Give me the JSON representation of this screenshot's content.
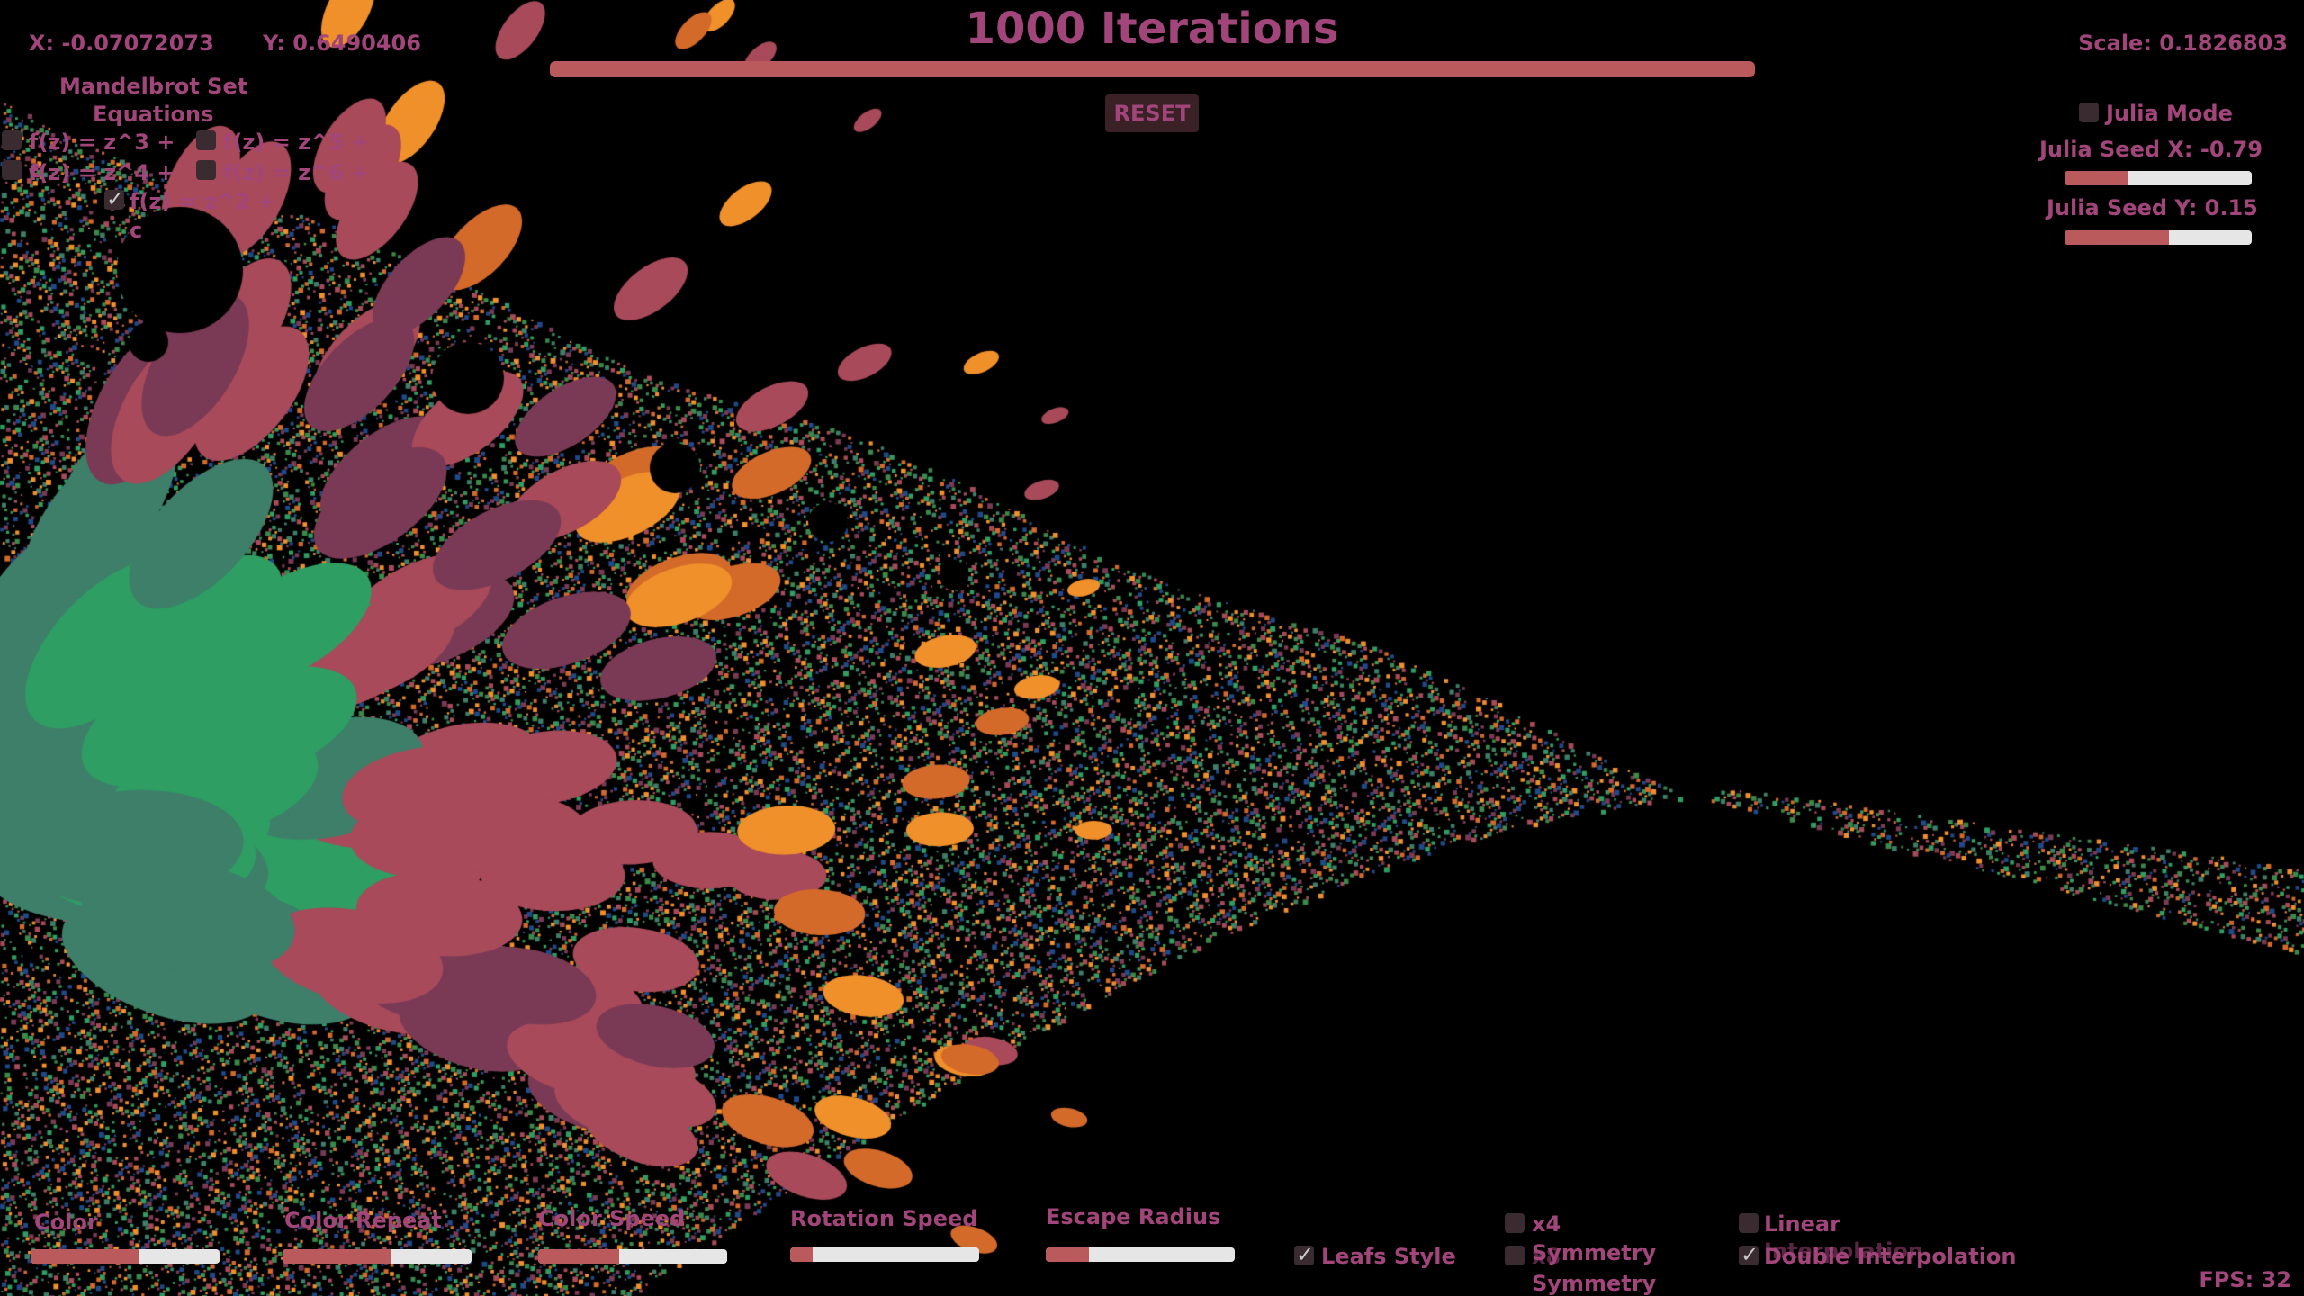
{
  "coords": {
    "x_label": "X: -0.07072073",
    "y_label": "Y: 0.6490406",
    "scale_label": "Scale: 0.1826803"
  },
  "iterations": {
    "title": "1000 Iterations",
    "progress": 1.0
  },
  "reset_label": "RESET",
  "equations": {
    "header_line1": "Mandelbrot Set",
    "header_line2": "Equations",
    "items": [
      {
        "label": "f(z) = z^3 +",
        "checked": false
      },
      {
        "label": "f(z) = z^5 +",
        "checked": false
      },
      {
        "label": "f(z) = z^4 +",
        "checked": false
      },
      {
        "label": "f(z) = z^6 +",
        "checked": false
      },
      {
        "label": "f(z) = z^2 +",
        "checked": true
      }
    ],
    "overflow_c1": "c",
    "overflow_c2": "c"
  },
  "julia": {
    "mode_label": "Julia Mode",
    "mode_checked": false,
    "seed_x_label": "Julia Seed X: -0.79",
    "seed_x_level": 0.34,
    "seed_y_label": "Julia Seed Y: 0.15",
    "seed_y_level": 0.56
  },
  "bottom_sliders": [
    {
      "label": "Color",
      "level": 0.57
    },
    {
      "label": "Color Repeat",
      "level": 0.57
    },
    {
      "label": "Color Speed",
      "level": 0.43
    },
    {
      "label": "Rotation Speed",
      "level": 0.12
    },
    {
      "label": "Escape Radius",
      "level": 0.23
    }
  ],
  "options": {
    "leafs_label": "Leafs Style",
    "leafs_checked": true,
    "x4_label": "x4",
    "x4_checked": false,
    "x8_label": "x8",
    "x8_checked": false,
    "symmetry_label": "Symmetry",
    "symmetry_label2": "Symmetry",
    "linear_label": "Linear",
    "linear_label2": "Interpolation",
    "linear_checked": false,
    "double_label": "Double Interpolation",
    "double_checked": true
  },
  "fps_label": "FPS: 32",
  "colors": {
    "accent_text": "#a2457a",
    "slider_fill": "#bb5a5c",
    "slider_track": "#e6e6e6",
    "fractal_palette": [
      "#2e9e63",
      "#3e7f6a",
      "#7a3a55",
      "#a84a5a",
      "#d46a2a",
      "#f0902a",
      "#1f4a8a",
      "#3a8a4a"
    ]
  }
}
